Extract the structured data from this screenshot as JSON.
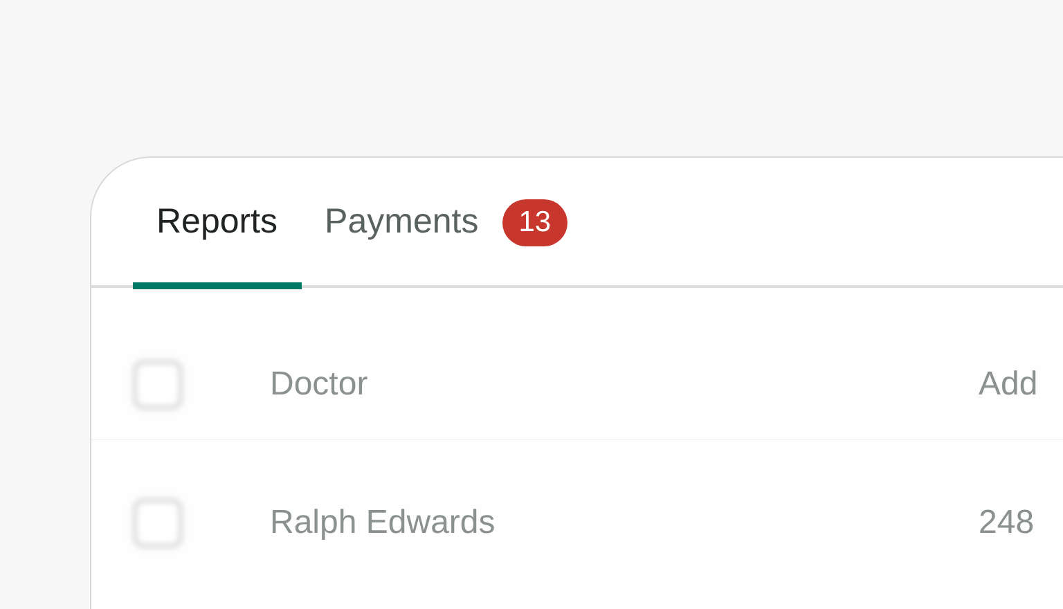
{
  "tabs": [
    {
      "label": "Reports",
      "selected": true
    },
    {
      "label": "Payments",
      "selected": false,
      "badge": "13"
    }
  ],
  "table": {
    "select_all": {
      "checked": false
    },
    "columns": [
      "Doctor",
      "Add"
    ],
    "rows": [
      {
        "checked": false,
        "cells": [
          "Ralph Edwards",
          "248"
        ]
      }
    ]
  }
}
